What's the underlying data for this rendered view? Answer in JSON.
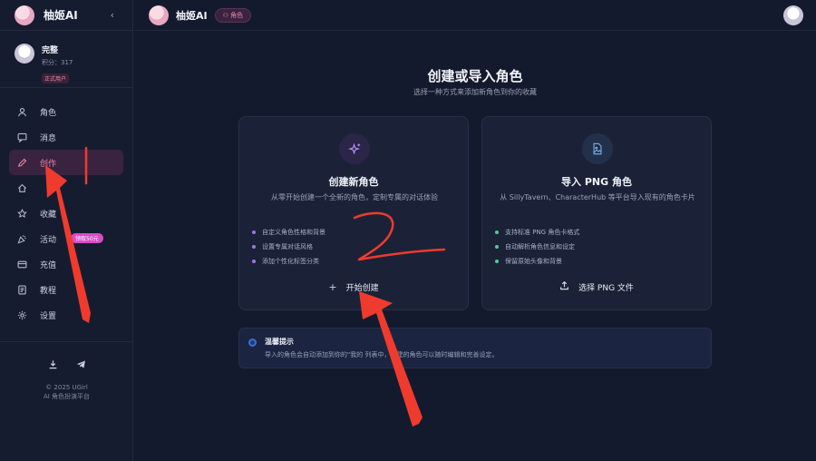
{
  "app": {
    "name": "柚姬AI",
    "collapse_icon": "chevron-left-icon"
  },
  "user": {
    "name": "完整",
    "points": "积分：317",
    "badge": "正式用户"
  },
  "nav": {
    "items": [
      {
        "label": "角色",
        "icon": "person-icon"
      },
      {
        "label": "消息",
        "icon": "chat-icon"
      },
      {
        "label": "创作",
        "icon": "pencil-icon",
        "active": true
      },
      {
        "label": "",
        "icon": "home-icon"
      },
      {
        "label": "收藏",
        "icon": "star-icon"
      },
      {
        "label": "活动",
        "icon": "party-icon",
        "badge": "领取50元"
      },
      {
        "label": "充值",
        "icon": "card-icon"
      },
      {
        "label": "教程",
        "icon": "book-icon"
      },
      {
        "label": "设置",
        "icon": "gear-icon"
      }
    ]
  },
  "footer": {
    "copyright": "© 2025 UGirl",
    "tagline": "AI 角色扮演平台"
  },
  "header": {
    "title": "柚姬AI",
    "pill": "角色"
  },
  "main": {
    "title": "创建或导入角色",
    "subtitle": "选择一种方式来添加新角色到你的收藏",
    "cards": [
      {
        "title": "创建新角色",
        "desc": "从零开始创建一个全新的角色，定制专属的对话体验",
        "bullets": [
          "自定义角色性格和背景",
          "设置专属对话风格",
          "添加个性化标签分类"
        ],
        "button": "开始创建"
      },
      {
        "title": "导入 PNG 角色",
        "desc": "从 SillyTavern、CharacterHub 等平台导入现有的角色卡片",
        "bullets": [
          "支持标准 PNG 角色卡格式",
          "自动解析角色信息和设定",
          "保留原始头像和背景"
        ],
        "button": "选择 PNG 文件"
      }
    ],
    "tip": {
      "title": "温馨提示",
      "text": "导入的角色会自动添加到你的\"我的      列表中，创建的角色可以随时编辑和完善设定。"
    }
  },
  "annotation": {
    "color": "#ef3b2d",
    "handwritten": "2"
  }
}
